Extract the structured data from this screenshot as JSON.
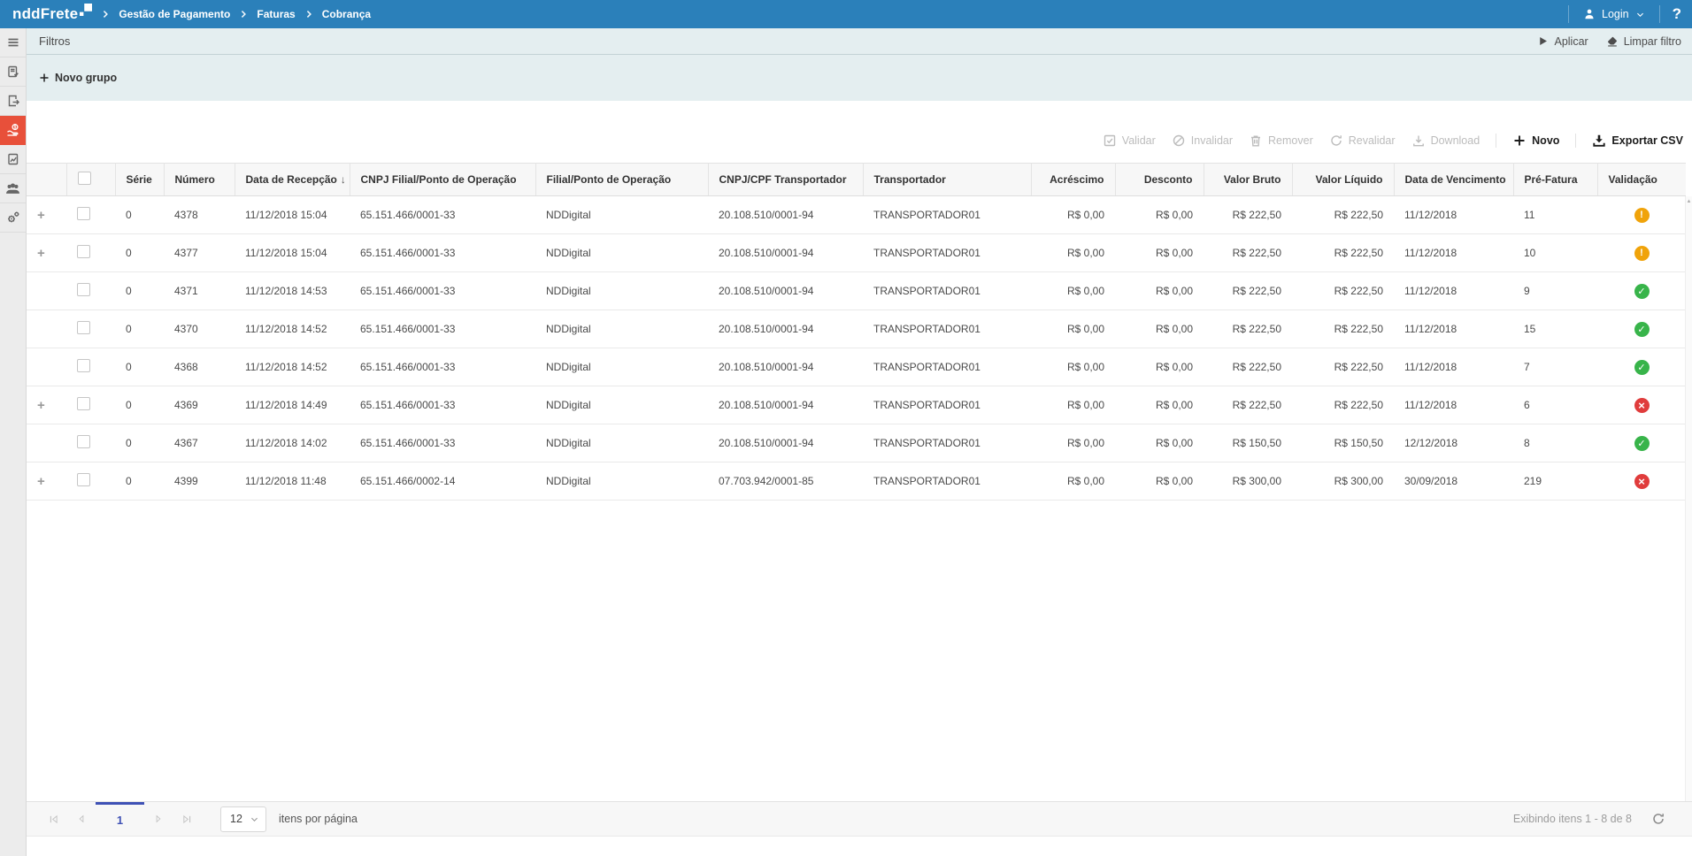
{
  "topbar": {
    "brand": "nddFrete",
    "breadcrumb": [
      "Gestão de Pagamento",
      "Faturas",
      "Cobrança"
    ],
    "login_label": "Login",
    "help_label": "?"
  },
  "sidebar": {
    "items": [
      {
        "icon": "menu-icon",
        "active": false
      },
      {
        "icon": "clipboard-check-icon",
        "active": false
      },
      {
        "icon": "document-export-icon",
        "active": false
      },
      {
        "icon": "payment-hand-coin-icon",
        "active": true
      },
      {
        "icon": "document-report-icon",
        "active": false
      },
      {
        "icon": "users-icon",
        "active": false
      },
      {
        "icon": "settings-gears-icon",
        "active": false
      }
    ]
  },
  "filters": {
    "title": "Filtros",
    "apply_label": "Aplicar",
    "clear_label": "Limpar filtro",
    "new_group_label": "Novo grupo"
  },
  "toolbar": {
    "actions": [
      {
        "label": "Validar",
        "icon": "check-square-icon",
        "enabled": false
      },
      {
        "label": "Invalidar",
        "icon": "ban-icon",
        "enabled": false
      },
      {
        "label": "Remover",
        "icon": "trash-icon",
        "enabled": false
      },
      {
        "label": "Revalidar",
        "icon": "refresh-icon",
        "enabled": false
      },
      {
        "label": "Download",
        "icon": "download-icon",
        "enabled": false
      },
      {
        "label": "Novo",
        "icon": "plus-icon",
        "enabled": true
      },
      {
        "label": "Exportar CSV",
        "icon": "export-csv-icon",
        "enabled": true
      }
    ]
  },
  "table": {
    "columns": {
      "serie": "Série",
      "numero": "Número",
      "recepcao": "Data de Recepção",
      "cnpj_filial": "CNPJ Filial/Ponto de Operação",
      "filial": "Filial/Ponto de Operação",
      "cnpj_transp": "CNPJ/CPF Transportador",
      "transportador": "Transportador",
      "acrescimo": "Acréscimo",
      "desconto": "Desconto",
      "bruto": "Valor Bruto",
      "liquido": "Valor Líquido",
      "vencimento": "Data de Vencimento",
      "prefatura": "Pré-Fatura",
      "validacao": "Validação"
    },
    "sort": {
      "column": "recepcao",
      "direction": "down",
      "glyph": "↓"
    },
    "rows": [
      {
        "expandable": true,
        "serie": "0",
        "numero": "4378",
        "recepcao": "11/12/2018 15:04",
        "cnpj_filial": "65.151.466/0001-33",
        "filial": "NDDigital",
        "cnpj_transp": "20.108.510/0001-94",
        "transportador": "TRANSPORTADOR01",
        "acrescimo": "R$ 0,00",
        "desconto": "R$ 0,00",
        "bruto": "R$ 222,50",
        "liquido": "R$ 222,50",
        "vencimento": "11/12/2018",
        "prefatura": "11",
        "validacao": "warning"
      },
      {
        "expandable": true,
        "serie": "0",
        "numero": "4377",
        "recepcao": "11/12/2018 15:04",
        "cnpj_filial": "65.151.466/0001-33",
        "filial": "NDDigital",
        "cnpj_transp": "20.108.510/0001-94",
        "transportador": "TRANSPORTADOR01",
        "acrescimo": "R$ 0,00",
        "desconto": "R$ 0,00",
        "bruto": "R$ 222,50",
        "liquido": "R$ 222,50",
        "vencimento": "11/12/2018",
        "prefatura": "10",
        "validacao": "warning"
      },
      {
        "expandable": false,
        "serie": "0",
        "numero": "4371",
        "recepcao": "11/12/2018 14:53",
        "cnpj_filial": "65.151.466/0001-33",
        "filial": "NDDigital",
        "cnpj_transp": "20.108.510/0001-94",
        "transportador": "TRANSPORTADOR01",
        "acrescimo": "R$ 0,00",
        "desconto": "R$ 0,00",
        "bruto": "R$ 222,50",
        "liquido": "R$ 222,50",
        "vencimento": "11/12/2018",
        "prefatura": "9",
        "validacao": "success"
      },
      {
        "expandable": false,
        "serie": "0",
        "numero": "4370",
        "recepcao": "11/12/2018 14:52",
        "cnpj_filial": "65.151.466/0001-33",
        "filial": "NDDigital",
        "cnpj_transp": "20.108.510/0001-94",
        "transportador": "TRANSPORTADOR01",
        "acrescimo": "R$ 0,00",
        "desconto": "R$ 0,00",
        "bruto": "R$ 222,50",
        "liquido": "R$ 222,50",
        "vencimento": "11/12/2018",
        "prefatura": "15",
        "validacao": "success"
      },
      {
        "expandable": false,
        "serie": "0",
        "numero": "4368",
        "recepcao": "11/12/2018 14:52",
        "cnpj_filial": "65.151.466/0001-33",
        "filial": "NDDigital",
        "cnpj_transp": "20.108.510/0001-94",
        "transportador": "TRANSPORTADOR01",
        "acrescimo": "R$ 0,00",
        "desconto": "R$ 0,00",
        "bruto": "R$ 222,50",
        "liquido": "R$ 222,50",
        "vencimento": "11/12/2018",
        "prefatura": "7",
        "validacao": "success"
      },
      {
        "expandable": true,
        "serie": "0",
        "numero": "4369",
        "recepcao": "11/12/2018 14:49",
        "cnpj_filial": "65.151.466/0001-33",
        "filial": "NDDigital",
        "cnpj_transp": "20.108.510/0001-94",
        "transportador": "TRANSPORTADOR01",
        "acrescimo": "R$ 0,00",
        "desconto": "R$ 0,00",
        "bruto": "R$ 222,50",
        "liquido": "R$ 222,50",
        "vencimento": "11/12/2018",
        "prefatura": "6",
        "validacao": "error"
      },
      {
        "expandable": false,
        "serie": "0",
        "numero": "4367",
        "recepcao": "11/12/2018 14:02",
        "cnpj_filial": "65.151.466/0001-33",
        "filial": "NDDigital",
        "cnpj_transp": "20.108.510/0001-94",
        "transportador": "TRANSPORTADOR01",
        "acrescimo": "R$ 0,00",
        "desconto": "R$ 0,00",
        "bruto": "R$ 150,50",
        "liquido": "R$ 150,50",
        "vencimento": "12/12/2018",
        "prefatura": "8",
        "validacao": "success"
      },
      {
        "expandable": true,
        "serie": "0",
        "numero": "4399",
        "recepcao": "11/12/2018 11:48",
        "cnpj_filial": "65.151.466/0002-14",
        "filial": "NDDigital",
        "cnpj_transp": "07.703.942/0001-85",
        "transportador": "TRANSPORTADOR01",
        "acrescimo": "R$ 0,00",
        "desconto": "R$ 0,00",
        "bruto": "R$ 300,00",
        "liquido": "R$ 300,00",
        "vencimento": "30/09/2018",
        "prefatura": "219",
        "validacao": "error"
      }
    ],
    "status_glyphs": {
      "warning": "!",
      "success": "✓",
      "error": "×"
    }
  },
  "pagination": {
    "current_page": "1",
    "page_size": "12",
    "items_per_page_label": "itens por página",
    "summary": "Exibindo itens 1 - 8 de 8"
  },
  "colors": {
    "topbar_blue": "#2b80ba",
    "sidebar_active_red": "#e8503a",
    "filters_bg": "#e4eef0",
    "status_warning": "#f0a30a",
    "status_success": "#38b44a",
    "status_error": "#e03c3c",
    "page_active_blue": "#3f51b5"
  }
}
